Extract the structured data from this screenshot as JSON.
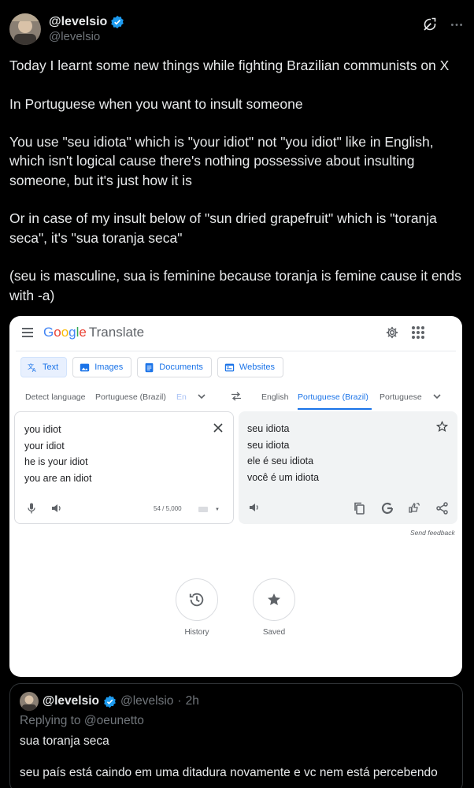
{
  "tweet": {
    "display_name": "@levelsio",
    "handle": "@levelsio",
    "paragraphs": [
      "Today I learnt some new things while fighting Brazilian communists on X",
      "In Portuguese when you want to insult someone",
      "You use \"seu idiota\" which is \"your idiot\" not \"you idiot\" like in English, which isn't logical cause there's nothing possessive about insulting someone, but it's just how it is",
      "Or in case of my insult below of \"sun dried grapefruit\" which is \"toranja seca\", it's \"sua toranja seca\"",
      "(seu is masculine, sua is feminine because toranja is femine cause it ends with -a)"
    ],
    "icons": {
      "verified": "verified-badge-icon",
      "grok": "grok-icon",
      "more": "more-options-icon"
    },
    "colors": {
      "verified": "#1d9bf0",
      "background": "#000000",
      "secondary_text": "#71767b"
    }
  },
  "translate": {
    "logo": {
      "G": "G",
      "o1": "o",
      "o2": "o",
      "g": "g",
      "l": "l",
      "e": "e",
      "product": "Translate"
    },
    "modes": [
      {
        "label": "Text",
        "icon": "translate-icon"
      },
      {
        "label": "Images",
        "icon": "image-icon"
      },
      {
        "label": "Documents",
        "icon": "document-icon"
      },
      {
        "label": "Websites",
        "icon": "website-icon"
      }
    ],
    "source_langs": [
      "Detect language",
      "Portuguese (Brazil)",
      "En"
    ],
    "target_langs": [
      "English",
      "Portuguese (Brazil)",
      "Portuguese"
    ],
    "source_lines": [
      "you idiot",
      "your idiot",
      "he is your idiot",
      "you are an idiot"
    ],
    "target_lines": [
      "seu idiota",
      "seu idiota",
      "ele é seu idiota",
      "você é um idiota"
    ],
    "char_count": "54 / 5,000",
    "send_feedback": "Send feedback",
    "history_label": "History",
    "saved_label": "Saved"
  },
  "quote": {
    "display_name": "@levelsio",
    "handle": "@levelsio",
    "time": "2h",
    "replying_to": "Replying to @oeunetto",
    "lines": [
      "sua toranja seca",
      "seu país está caindo em uma ditadura novamente e vc nem está percebendo"
    ]
  }
}
